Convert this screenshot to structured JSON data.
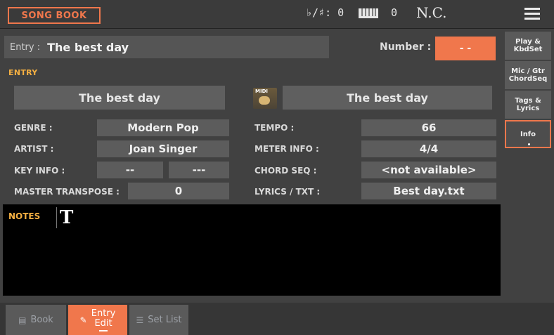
{
  "header": {
    "app_button": "SONG BOOK",
    "transpose": "♭/♯: 0",
    "keyboard_value": "0",
    "chord": "N.C."
  },
  "entry": {
    "label": "Entry :",
    "value": "The best day"
  },
  "number": {
    "label": "Number :",
    "value": "- -"
  },
  "section_entry": "ENTRY",
  "style_name": "The best day",
  "midi_label": "MIDI",
  "midi_name": "The best day",
  "fields": {
    "genre_label": "GENRE :",
    "genre": "Modern Pop",
    "artist_label": "ARTIST :",
    "artist": "Joan Singer",
    "key_label": "KEY INFO :",
    "key1": "--",
    "key2": "---",
    "transpose_label": "MASTER TRANSPOSE :",
    "transpose": "0",
    "tempo_label": "TEMPO :",
    "tempo": "66",
    "meter_label": "METER INFO :",
    "meter": "4/4",
    "chordseq_label": "CHORD SEQ :",
    "chordseq": "<not available>",
    "lyrics_label": "LYRICS / TXT :",
    "lyrics": "Best day.txt"
  },
  "notes": {
    "label": "NOTES",
    "icon_text": "T"
  },
  "side_tabs": [
    {
      "label": "Play &\nKbdSet"
    },
    {
      "label": "Mic / Gtr\nChordSeq"
    },
    {
      "label": "Tags &\nLyrics"
    },
    {
      "label": "Info"
    }
  ],
  "bottom_tabs": {
    "book": "Book",
    "entry_edit": "Entry\nEdit",
    "set_list": "Set List"
  },
  "colors": {
    "accent": "#f0774c",
    "section": "#f5b042"
  }
}
